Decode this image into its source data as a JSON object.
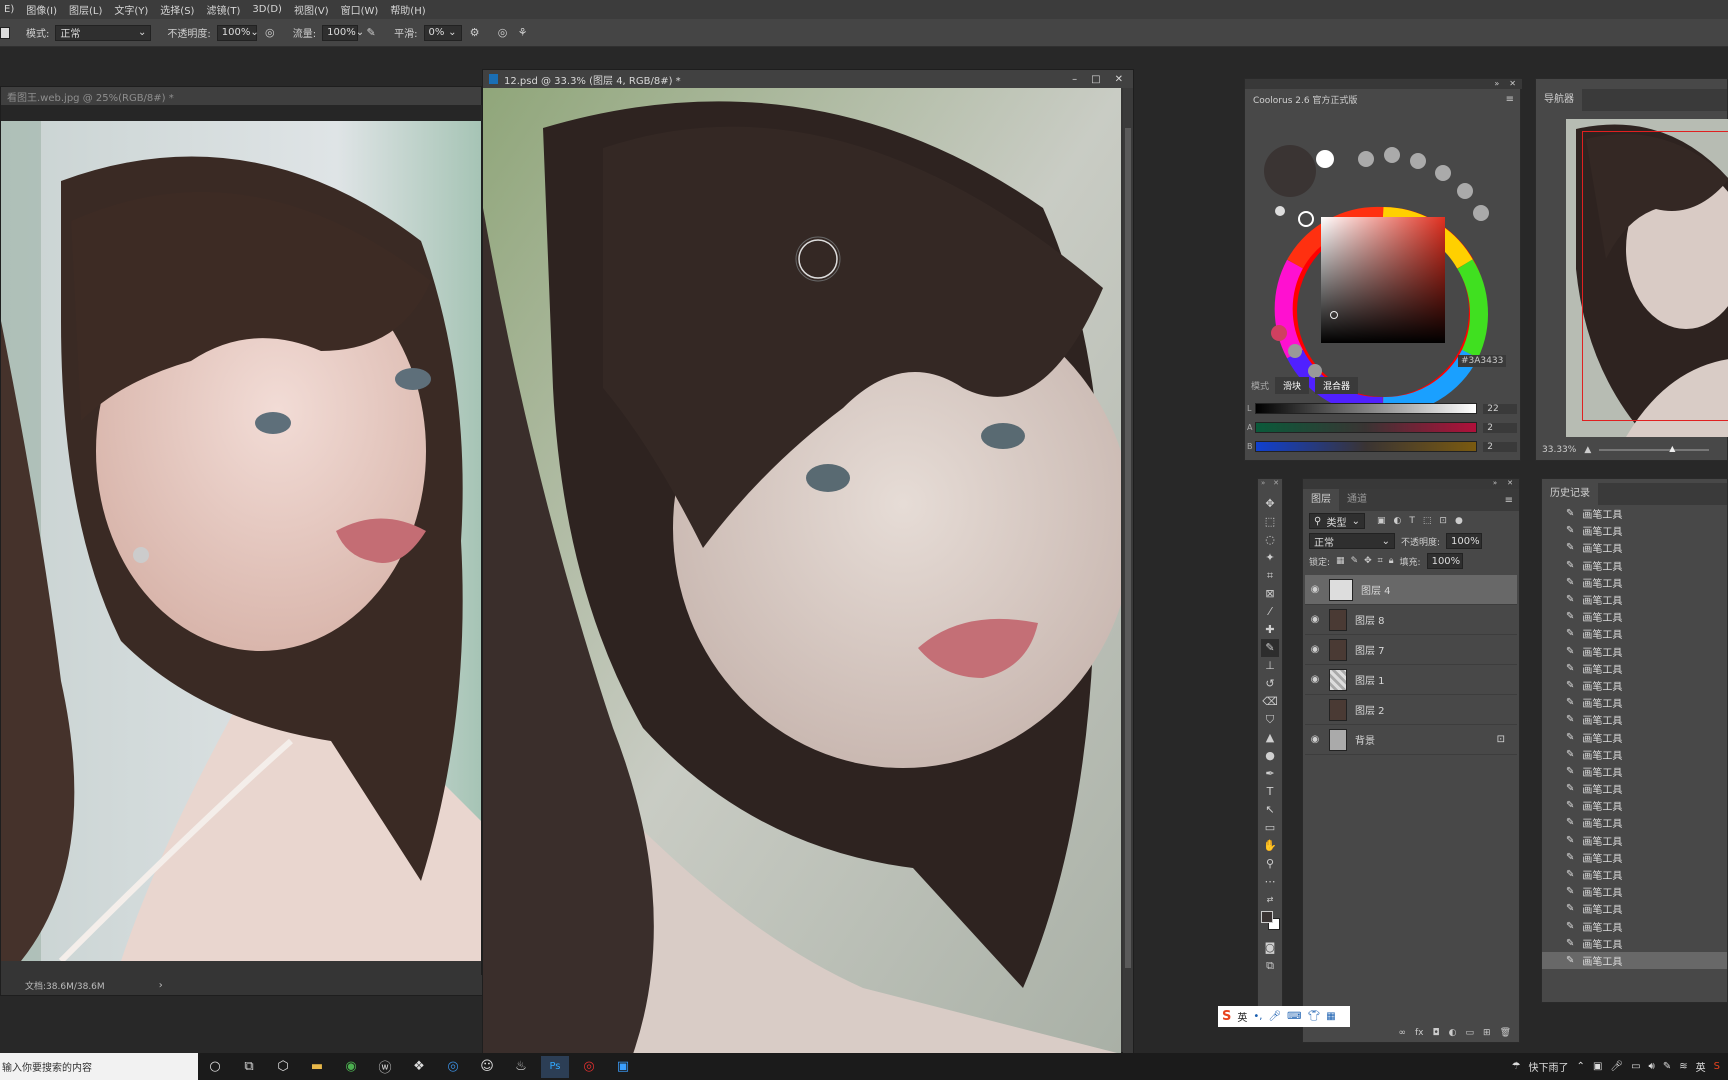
{
  "menu": [
    "E)",
    "图像(I)",
    "图层(L)",
    "文字(Y)",
    "选择(S)",
    "滤镜(T)",
    "3D(D)",
    "视图(V)",
    "窗口(W)",
    "帮助(H)"
  ],
  "options": {
    "mode_label": "模式:",
    "mode_value": "正常",
    "opacity_label": "不透明度:",
    "opacity_value": "100%",
    "flow_label": "流量:",
    "flow_value": "100%",
    "smooth_label": "平滑:",
    "smooth_value": "0%"
  },
  "doc_left": {
    "title": "看图王.web.jpg @ 25%(RGB/8#) *",
    "status": "文档:38.6M/38.6M"
  },
  "doc_main": {
    "title": "12.psd @ 33.3% (图层 4, RGB/8#) *"
  },
  "coolorus": {
    "title": "Coolorus 2.6 官方正式版",
    "hex": "#3A3433",
    "mode_label": "模式",
    "tab_slider": "滑块",
    "tab_mixer": "混合器",
    "sliders": [
      {
        "label": "L",
        "value": "22"
      },
      {
        "label": "A",
        "value": "2"
      },
      {
        "label": "B",
        "value": "2"
      }
    ],
    "current_color": "#3a3433"
  },
  "navigator": {
    "title": "导航器",
    "zoom": "33.33%"
  },
  "layers_panel": {
    "tab_layers": "图层",
    "tab_channels": "通道",
    "filter_label": "类型",
    "blend_mode": "正常",
    "opacity_label": "不透明度:",
    "opacity_value": "100%",
    "lock_label": "锁定:",
    "fill_label": "填充:",
    "fill_value": "100%",
    "layers": [
      {
        "name": "图层 4",
        "visible": true,
        "selected": true
      },
      {
        "name": "图层 8",
        "visible": true,
        "selected": false
      },
      {
        "name": "图层 7",
        "visible": true,
        "selected": false
      },
      {
        "name": "图层 1",
        "visible": true,
        "selected": false
      },
      {
        "name": "图层 2",
        "visible": false,
        "selected": false
      },
      {
        "name": "背景",
        "visible": true,
        "selected": false
      }
    ]
  },
  "history": {
    "title": "历史记录",
    "item_label": "画笔工具",
    "count": 27
  },
  "ime": {
    "label": "英"
  },
  "taskbar": {
    "search_placeholder": "输入你要搜索的内容",
    "weather": "快下雨了",
    "lang": "英"
  }
}
